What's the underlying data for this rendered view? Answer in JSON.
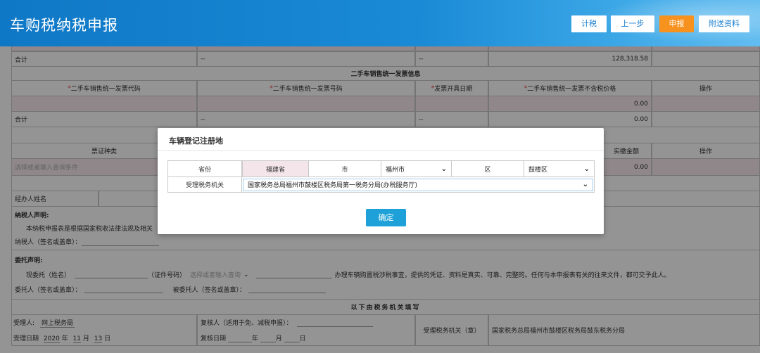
{
  "header": {
    "title": "车购税纳税申报",
    "buttons": {
      "calc": "计税",
      "prev": "上一步",
      "submit": "申报",
      "attach": "附送资料"
    }
  },
  "table1_total": {
    "label": "合计",
    "c2": "--",
    "c3": "--",
    "amount": "128,318.58"
  },
  "used_car": {
    "section_title": "二手车销售统一发票信息",
    "headers": [
      "二手车销售统一发票代码",
      "二手车销售统一发票号码",
      "发票开具日期",
      "二手车销售统一发票不含税价格",
      "操作"
    ],
    "row_amount": "0.00",
    "total_label": "合计",
    "total_c2": "--",
    "total_c3": "--",
    "total_amount": "0.00"
  },
  "voucher": {
    "header_type": "票证种类",
    "header_paid": "实缴金额",
    "header_op": "操作",
    "type_placeholder": "选择或者输入查询条件",
    "paid_amount": "0.00"
  },
  "agent": {
    "label": "经办人姓名"
  },
  "taxpayer_decl": {
    "title": "纳税人声明:",
    "text": "本纳税申报表是根据国家税收法律法规及相关",
    "sign": "纳税人（签名或盖章）："
  },
  "entrust": {
    "title": "委托声明:",
    "now": "现委托（姓名）",
    "id_type": "（证件号码）",
    "id_placeholder": "选择或者输入查询",
    "desc": "办理车辆购置税涉税事宜，提供的凭证、资料是真实、可靠、完整的。任何与本申报表有关的往来文件，都可交予此人。",
    "principal": "委托人（签名或盖章）：",
    "agent": "被委托人（签名或盖章）："
  },
  "tax_office": {
    "title": "以下由税务机关填写",
    "receiver_label": "受理人:",
    "receiver": "网上税务局",
    "reviewer_label": "复核人（适用于免、减税申报）：",
    "office_label": "受理税务机关（章）",
    "office_value": "国家税务总局福州市鼓楼区税务局鼓东税务分局",
    "date_label": "受理日期",
    "year": "2020",
    "year_unit": "年",
    "month": "11",
    "month_unit": "月",
    "day": "13",
    "day_unit": "日",
    "review_date_label": "复核日期",
    "r_year_unit": "年",
    "r_month_unit": "月",
    "r_day_unit": "日"
  },
  "modal": {
    "title": "车辆登记注册地",
    "province_label": "省份",
    "province_value": "福建省",
    "city_label": "市",
    "city_value": "福州市",
    "district_label": "区",
    "district_value": "鼓楼区",
    "office_label": "受理税务机关",
    "office_value": "国家税务总局福州市鼓楼区税务局第一税务分局(办税服务厅)",
    "confirm": "确定"
  }
}
